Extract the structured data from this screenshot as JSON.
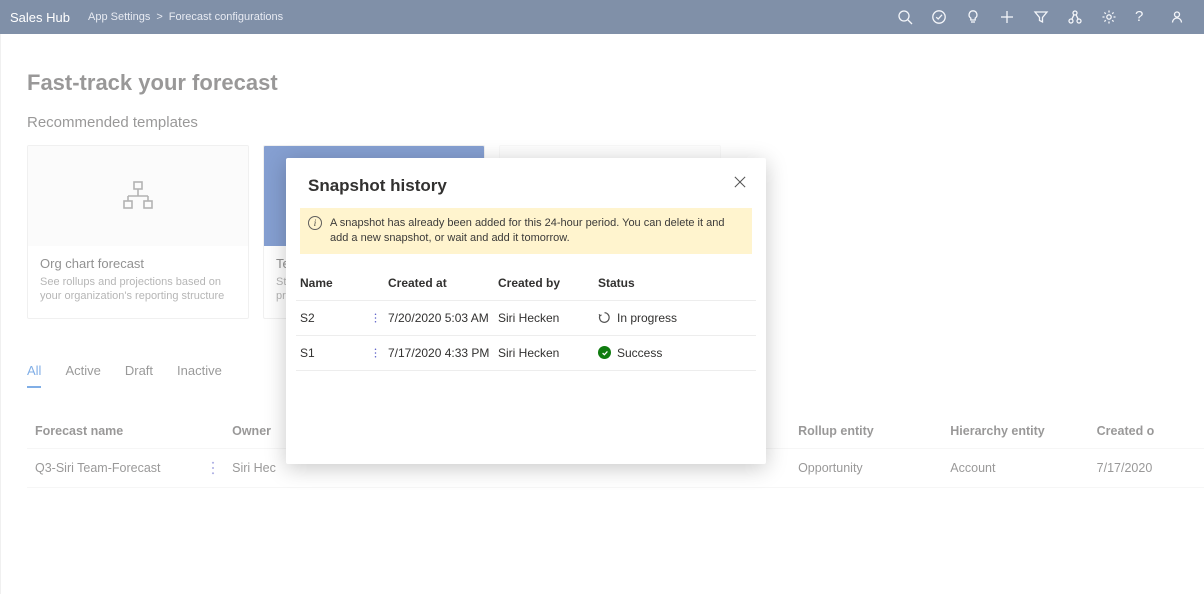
{
  "topbar": {
    "brand": "Sales Hub",
    "breadcrumb": [
      "App Settings",
      "Forecast configurations"
    ],
    "icons": [
      "search",
      "task-check",
      "lightbulb",
      "plus",
      "filter",
      "relationship",
      "settings",
      "help",
      "user"
    ]
  },
  "page": {
    "title": "Fast-track your forecast",
    "section": "Recommended templates"
  },
  "cards": [
    {
      "title": "Org chart forecast",
      "desc": "See rollups and projections based on your organization's reporting structure"
    },
    {
      "title": "Te",
      "desc_partial1": "Str",
      "desc_partial2": "pr"
    }
  ],
  "tabs": [
    "All",
    "Active",
    "Draft",
    "Inactive"
  ],
  "grid": {
    "headers": {
      "name": "Forecast name",
      "owner": "Owner",
      "rollup": "Rollup entity",
      "hierarchy": "Hierarchy entity",
      "created": "Created o"
    },
    "rows": [
      {
        "name": "Q3-Siri Team-Forecast",
        "owner": "Siri Hec",
        "rollup": "Opportunity",
        "hierarchy": "Account",
        "created": "7/17/2020"
      }
    ]
  },
  "dialog": {
    "title": "Snapshot history",
    "info": "A snapshot has already been added for this 24-hour period. You can delete it and add a new snapshot, or wait and add it tomorrow.",
    "columns": {
      "name": "Name",
      "created": "Created at",
      "by": "Created by",
      "status": "Status"
    },
    "rows": [
      {
        "name": "S2",
        "created": "7/20/2020 5:03 AM",
        "by": "Siri Hecken",
        "status": "In progress",
        "state": "progress"
      },
      {
        "name": "S1",
        "created": "7/17/2020 4:33 PM",
        "by": "Siri Hecken",
        "status": "Success",
        "state": "success"
      }
    ]
  }
}
